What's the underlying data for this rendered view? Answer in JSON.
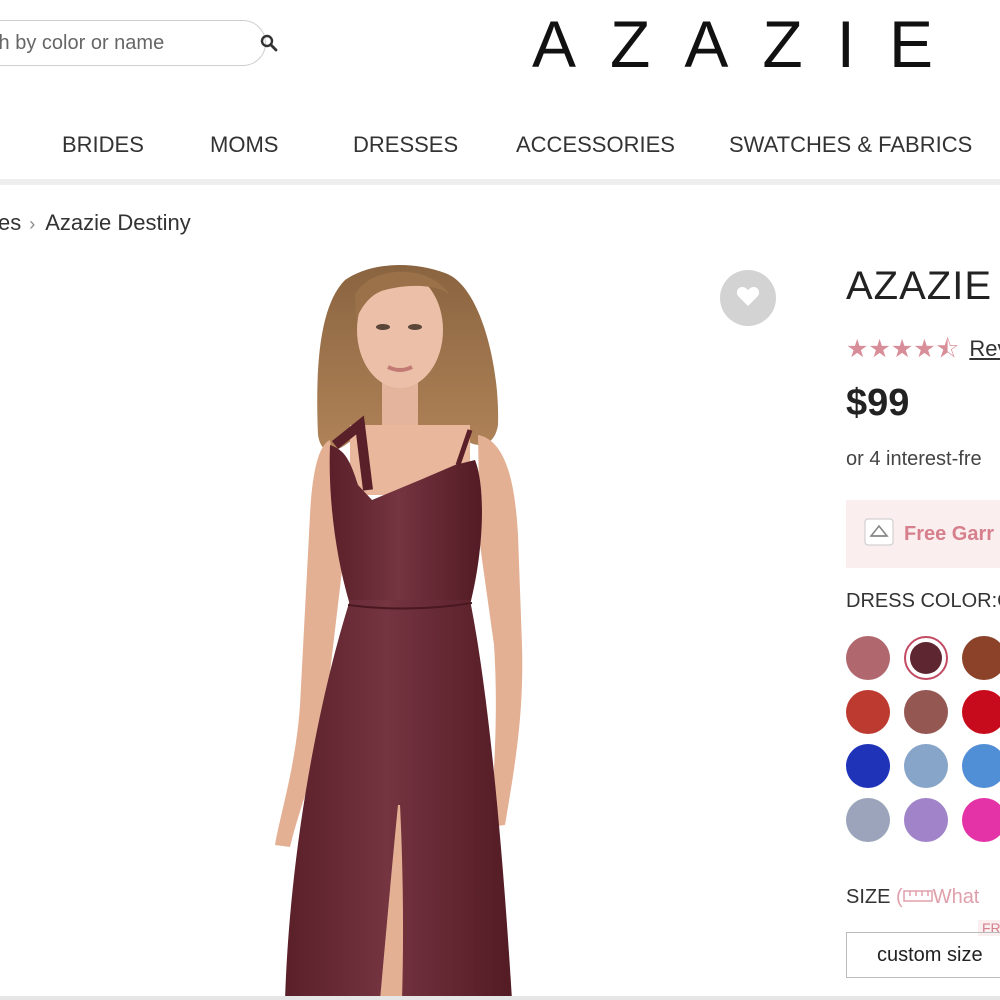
{
  "header": {
    "search_placeholder": "Search by color or name",
    "search_value": "th by color or name",
    "logo": "AZAZIE"
  },
  "nav": {
    "items": [
      "BRIDES",
      "MOMS",
      "DRESSES",
      "ACCESSORIES",
      "SWATCHES & FABRICS"
    ]
  },
  "breadcrumb": {
    "parent": "es",
    "current": "Azazie Destiny"
  },
  "product": {
    "title": "AZAZIE D",
    "stars": "★★★★⯪",
    "reviews_label": "Rev",
    "price": "$99",
    "installment_text": "or 4 interest-fre",
    "promo_text": "Free Garr",
    "color_label": "DRESS COLOR:C",
    "size_label": "SIZE",
    "size_guide": "What",
    "free_tag": "FR",
    "size_value": "custom size"
  },
  "colors": {
    "accent": "#d67f8d",
    "swatches": [
      {
        "hex": "#b0686e",
        "selected": false
      },
      {
        "hex": "#5e2630",
        "selected": true
      },
      {
        "hex": "#8b4229",
        "selected": false
      },
      {
        "hex": "#bd3a30",
        "selected": false
      },
      {
        "hex": "#955752",
        "selected": false
      },
      {
        "hex": "#c70b1c",
        "selected": false
      },
      {
        "hex": "#1e33b8",
        "selected": false
      },
      {
        "hex": "#86a5c9",
        "selected": false
      },
      {
        "hex": "#508ed6",
        "selected": false
      },
      {
        "hex": "#9ba4ba",
        "selected": false
      },
      {
        "hex": "#a083c8",
        "selected": false
      },
      {
        "hex": "#e433a6",
        "selected": false
      }
    ]
  },
  "icons": {
    "search": "search-icon",
    "favorite": "heart-icon",
    "promo": "garment-bag-icon",
    "size_guide": "ruler-icon"
  }
}
